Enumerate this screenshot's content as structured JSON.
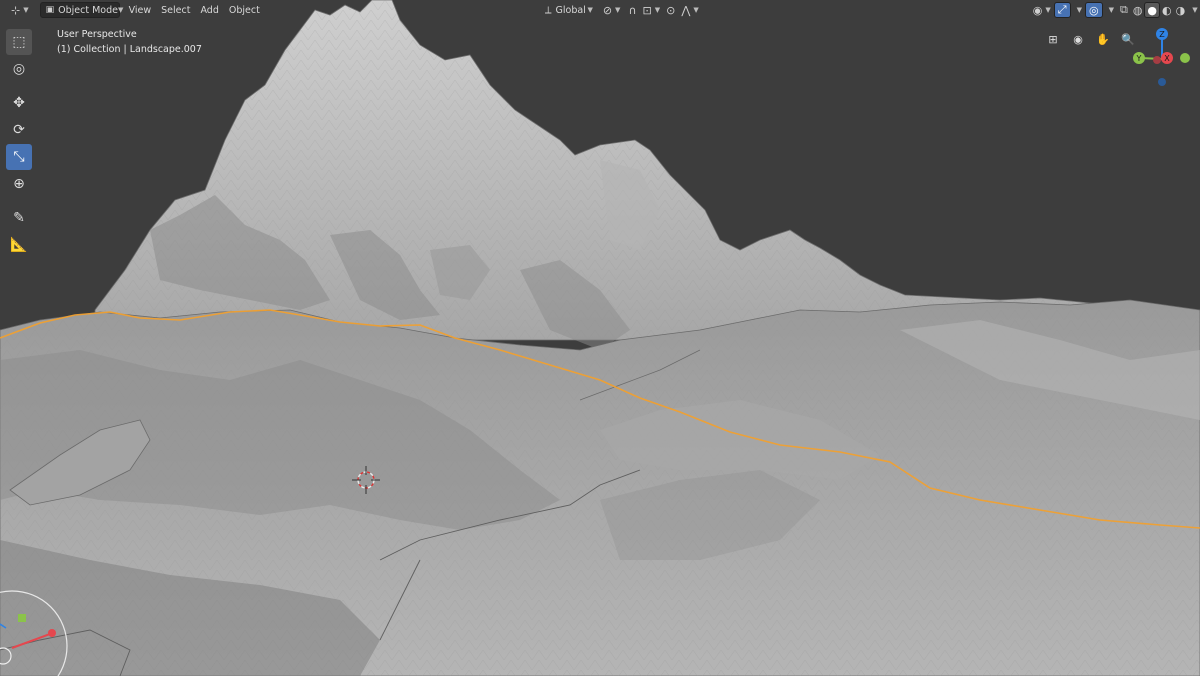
{
  "header": {
    "editor_type_icon": "axis-icon",
    "mode": "Object Mode",
    "menu": [
      "View",
      "Select",
      "Add",
      "Object"
    ],
    "orientation": "Global"
  },
  "overlay": {
    "view_name": "User Perspective",
    "collection_info": "(1) Collection | Landscape.007"
  },
  "gizmo": {
    "z_label": "Z",
    "y_label": "Y",
    "x_label": "X"
  },
  "toolbar": {
    "tools": [
      "select-box",
      "cursor",
      "move",
      "rotate",
      "scale",
      "transform",
      "annotate",
      "measure"
    ],
    "active_tool": "scale"
  },
  "colors": {
    "viewport_bg": "#3d3d3d",
    "selected_outline": "#f0a030",
    "active_tool": "#4772b3",
    "axis_x": "#e5474e",
    "axis_y": "#8bc34a",
    "axis_z": "#2f83e5"
  }
}
